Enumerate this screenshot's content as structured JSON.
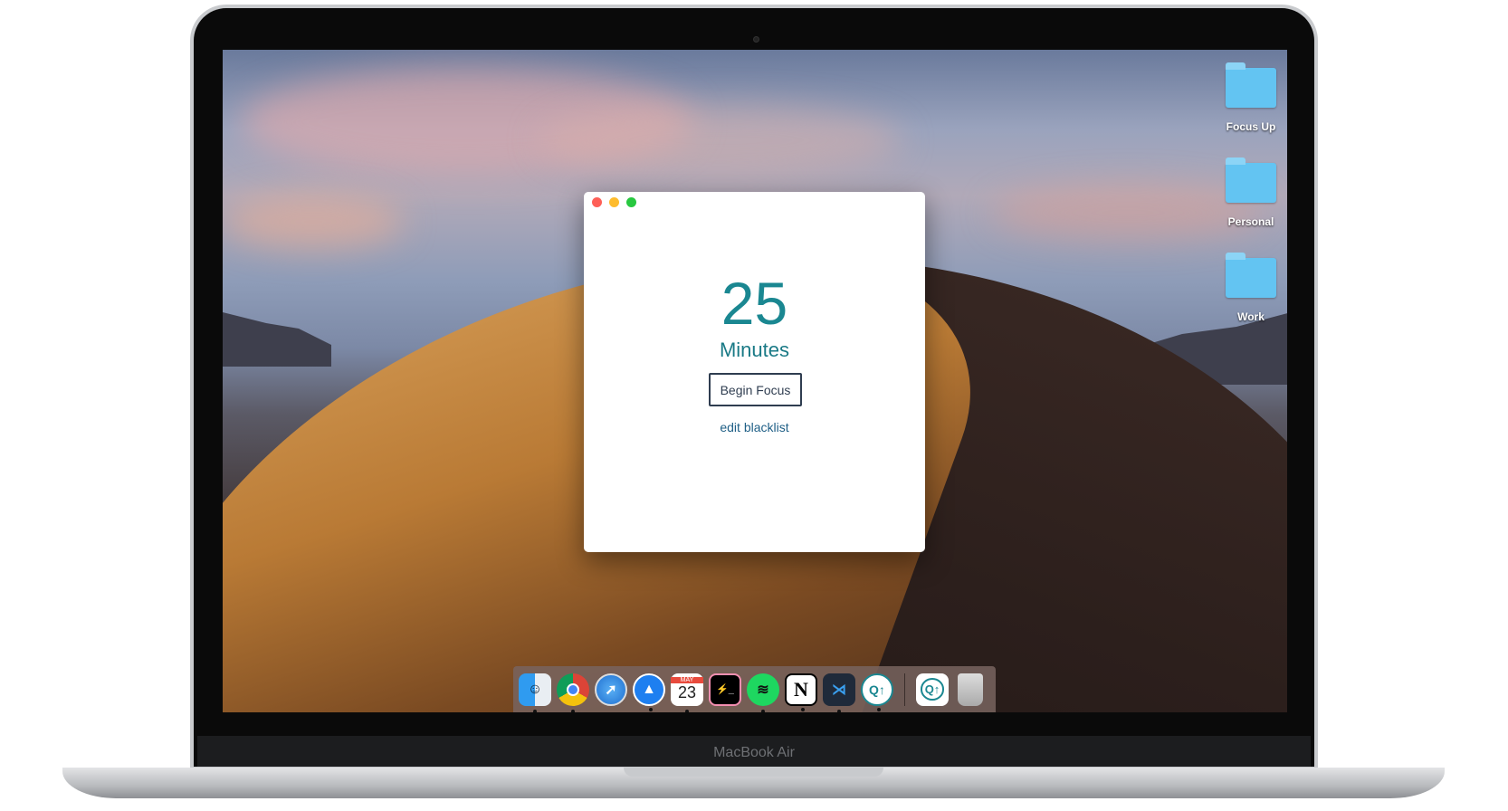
{
  "device": {
    "brand_label": "MacBook Air"
  },
  "desktop": {
    "folders": [
      {
        "label": "Focus Up"
      },
      {
        "label": "Personal"
      },
      {
        "label": "Work"
      }
    ]
  },
  "app_window": {
    "duration_value": "25",
    "duration_unit": "Minutes",
    "begin_button": "Begin Focus",
    "edit_link": "edit blacklist",
    "accent_color": "#1a8791"
  },
  "dock": {
    "apps": [
      {
        "name": "Finder",
        "running": true
      },
      {
        "name": "Chrome",
        "running": true
      },
      {
        "name": "Safari",
        "running": false
      },
      {
        "name": "Spark",
        "running": true
      },
      {
        "name": "Calendar",
        "month": "MAY",
        "day": "23",
        "running": true
      },
      {
        "name": "Terminal",
        "running": false
      },
      {
        "name": "Spotify",
        "running": true
      },
      {
        "name": "Notion",
        "glyph": "N",
        "running": true
      },
      {
        "name": "VS Code",
        "running": true
      },
      {
        "name": "Focus Up",
        "running": true
      }
    ],
    "stack": {
      "name": "Focus Up Downloads"
    },
    "trash": {
      "name": "Trash"
    }
  }
}
